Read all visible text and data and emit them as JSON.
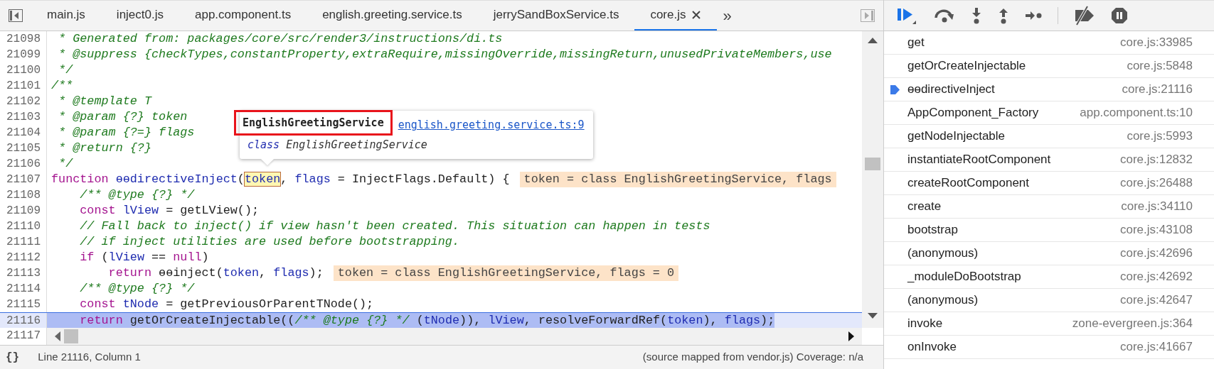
{
  "editor": {
    "tabs": [
      {
        "label": "main.js",
        "selected": false
      },
      {
        "label": "inject0.js",
        "selected": false
      },
      {
        "label": "app.component.ts",
        "selected": false
      },
      {
        "label": "english.greeting.service.ts",
        "selected": false
      },
      {
        "label": "jerrySandBoxService.ts",
        "selected": false
      },
      {
        "label": "core.js",
        "selected": true
      }
    ],
    "more_tabs": "»",
    "lines": [
      {
        "number": "21098",
        "current": false,
        "segments": [
          {
            "kind": "comment",
            "text": " * Generated from: packages/core/src/render3/instructions/di.ts"
          }
        ]
      },
      {
        "number": "21099",
        "current": false,
        "segments": [
          {
            "kind": "comment",
            "text": " * @suppress {checkTypes,constantProperty,extraRequire,missingOverride,missingReturn,unusedPrivateMembers,use"
          }
        ]
      },
      {
        "number": "21100",
        "current": false,
        "segments": [
          {
            "kind": "comment",
            "text": " */"
          }
        ]
      },
      {
        "number": "21101",
        "current": false,
        "segments": [
          {
            "kind": "comment",
            "text": "/**"
          }
        ]
      },
      {
        "number": "21102",
        "current": false,
        "segments": [
          {
            "kind": "comment",
            "text": " * @template T"
          }
        ]
      },
      {
        "number": "21103",
        "current": false,
        "segments": [
          {
            "kind": "comment",
            "text": " * @param {?} token"
          }
        ]
      },
      {
        "number": "21104",
        "current": false,
        "segments": [
          {
            "kind": "comment",
            "text": " * @param {?=} flags"
          }
        ]
      },
      {
        "number": "21105",
        "current": false,
        "segments": [
          {
            "kind": "comment",
            "text": " * @return {?}"
          }
        ]
      },
      {
        "number": "21106",
        "current": false,
        "segments": [
          {
            "kind": "comment",
            "text": " */"
          }
        ]
      },
      {
        "number": "21107",
        "current": false,
        "segments": [
          {
            "kind": "keyword",
            "text": "function "
          },
          {
            "kind": "variable",
            "text": "ɵɵdirectiveInject"
          },
          {
            "kind": "plain",
            "text": "("
          },
          {
            "kind": "hover",
            "text": "token"
          },
          {
            "kind": "plain",
            "text": ", "
          },
          {
            "kind": "variable",
            "text": "flags"
          },
          {
            "kind": "plain",
            "text": " = InjectFlags.Default) {"
          }
        ],
        "inline_value": "token = class EnglishGreetingService, flags"
      },
      {
        "number": "21108",
        "current": false,
        "segments": [
          {
            "kind": "comment",
            "text": "    /** @type {?} */"
          }
        ]
      },
      {
        "number": "21109",
        "current": false,
        "segments": [
          {
            "kind": "keyword",
            "text": "    const "
          },
          {
            "kind": "variable",
            "text": "lView"
          },
          {
            "kind": "plain",
            "text": " = getLView();"
          }
        ]
      },
      {
        "number": "21110",
        "current": false,
        "segments": [
          {
            "kind": "comment",
            "text": "    // Fall back to inject() if view hasn't been created. This situation can happen in tests"
          }
        ]
      },
      {
        "number": "21111",
        "current": false,
        "segments": [
          {
            "kind": "comment",
            "text": "    // if inject utilities are used before bootstrapping."
          }
        ]
      },
      {
        "number": "21112",
        "current": false,
        "segments": [
          {
            "kind": "keyword",
            "text": "    if"
          },
          {
            "kind": "plain",
            "text": " ("
          },
          {
            "kind": "variable",
            "text": "lView"
          },
          {
            "kind": "plain",
            "text": " == "
          },
          {
            "kind": "keyword",
            "text": "null"
          },
          {
            "kind": "plain",
            "text": ")"
          }
        ]
      },
      {
        "number": "21113",
        "current": false,
        "segments": [
          {
            "kind": "keyword",
            "text": "        return"
          },
          {
            "kind": "plain",
            "text": " ɵɵinject("
          },
          {
            "kind": "variable",
            "text": "token"
          },
          {
            "kind": "plain",
            "text": ", "
          },
          {
            "kind": "variable",
            "text": "flags"
          },
          {
            "kind": "plain",
            "text": ");"
          }
        ],
        "inline_value": "token = class EnglishGreetingService, flags = 0"
      },
      {
        "number": "21114",
        "current": false,
        "segments": [
          {
            "kind": "comment",
            "text": "    /** @type {?} */"
          }
        ]
      },
      {
        "number": "21115",
        "current": false,
        "segments": [
          {
            "kind": "keyword",
            "text": "    const "
          },
          {
            "kind": "variable",
            "text": "tNode"
          },
          {
            "kind": "plain",
            "text": " = getPreviousOrParentTNode();"
          }
        ]
      },
      {
        "number": "21116",
        "current": true,
        "segments": [
          {
            "kind": "keyword",
            "text": "    return"
          },
          {
            "kind": "plain",
            "text": " getOrCreateInjectable(("
          },
          {
            "kind": "comment",
            "text": "/** @type {?} */"
          },
          {
            "kind": "plain",
            "text": " ("
          },
          {
            "kind": "variable",
            "text": "tNode"
          },
          {
            "kind": "plain",
            "text": ")), "
          },
          {
            "kind": "variable",
            "text": "lView"
          },
          {
            "kind": "plain",
            "text": ", resolveForwardRef("
          },
          {
            "kind": "variable",
            "text": "token"
          },
          {
            "kind": "plain",
            "text": "), "
          },
          {
            "kind": "variable",
            "text": "flags"
          },
          {
            "kind": "plain",
            "text": ");"
          }
        ]
      },
      {
        "number": "21117",
        "current": false
      }
    ],
    "tooltip": {
      "title": "EnglishGreetingService",
      "link": "english.greeting.service.ts:9",
      "keyword": "class",
      "name": "EnglishGreetingService"
    }
  },
  "status_bar": {
    "pretty_print": "{}",
    "position": "Line 21116, Column 1",
    "source": "(source mapped from vendor.js) Coverage: n/a"
  },
  "call_stack": [
    {
      "function": "get",
      "location": "core.js:33985",
      "selected": false
    },
    {
      "function": "getOrCreateInjectable",
      "location": "core.js:5848",
      "selected": false
    },
    {
      "function": "ɵɵdirectiveInject",
      "location": "core.js:21116",
      "selected": true
    },
    {
      "function": "AppComponent_Factory",
      "location": "app.component.ts:10",
      "selected": false
    },
    {
      "function": "getNodeInjectable",
      "location": "core.js:5993",
      "selected": false
    },
    {
      "function": "instantiateRootComponent",
      "location": "core.js:12832",
      "selected": false
    },
    {
      "function": "createRootComponent",
      "location": "core.js:26488",
      "selected": false
    },
    {
      "function": "create",
      "location": "core.js:34110",
      "selected": false
    },
    {
      "function": "bootstrap",
      "location": "core.js:43108",
      "selected": false
    },
    {
      "function": "(anonymous)",
      "location": "core.js:42696",
      "selected": false
    },
    {
      "function": "_moduleDoBootstrap",
      "location": "core.js:42692",
      "selected": false
    },
    {
      "function": "(anonymous)",
      "location": "core.js:42647",
      "selected": false
    },
    {
      "function": "invoke",
      "location": "zone-evergreen.js:364",
      "selected": false
    },
    {
      "function": "onInvoke",
      "location": "core.js:41667",
      "selected": false
    }
  ]
}
